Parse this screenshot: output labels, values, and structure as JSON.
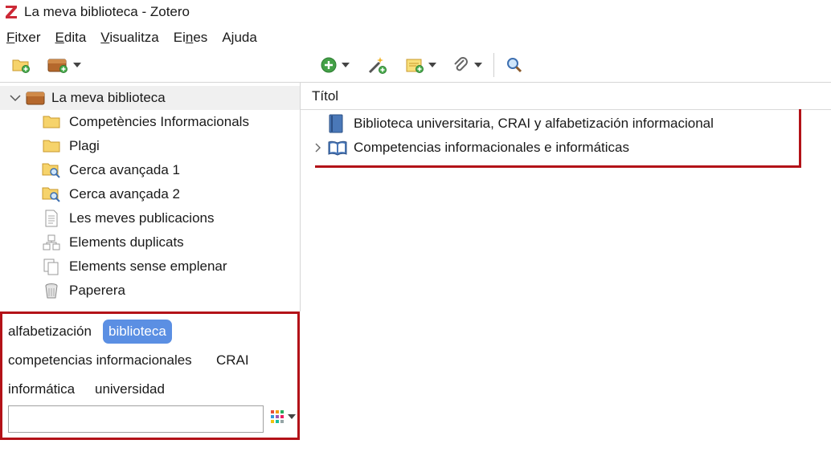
{
  "window": {
    "title": "La meva biblioteca - Zotero"
  },
  "menu": [
    {
      "label": "Fitxer",
      "mnemonic": "F",
      "rest": "itxer"
    },
    {
      "label": "Edita",
      "mnemonic": "E",
      "rest": "dita"
    },
    {
      "label": "Visualitza",
      "mnemonic": "V",
      "rest": "isualitza"
    },
    {
      "label": "Eines",
      "pre": "Ei",
      "mnemonic": "n",
      "rest": "es"
    },
    {
      "label": "Ajuda",
      "pre": "A",
      "mnemonic": "j",
      "rest": "uda"
    }
  ],
  "toolbar": {
    "icons": [
      "new-collection-icon",
      "new-library-icon",
      "new-item-icon",
      "add-by-identifier-icon",
      "new-note-icon",
      "attachment-icon",
      "search-icon"
    ]
  },
  "library": {
    "name": "La meva biblioteca",
    "collections": [
      {
        "label": "Competències Informacionals",
        "icon": "folder-icon"
      },
      {
        "label": "Plagi",
        "icon": "folder-icon"
      },
      {
        "label": "Cerca avançada 1",
        "icon": "saved-search-icon"
      },
      {
        "label": "Cerca avançada 2",
        "icon": "saved-search-icon"
      },
      {
        "label": "Les meves publicacions",
        "icon": "publications-icon"
      },
      {
        "label": "Elements duplicats",
        "icon": "duplicates-icon"
      },
      {
        "label": "Elements sense emplenar",
        "icon": "unfiled-icon"
      },
      {
        "label": "Paperera",
        "icon": "trash-icon"
      }
    ]
  },
  "items": {
    "column_title": "Títol",
    "rows": [
      {
        "title": "Biblioteca universitaria, CRAI y alfabetización informacional",
        "icon": "journal-article-icon"
      },
      {
        "title": "Competencias informacionales e informáticas",
        "icon": "book-icon"
      }
    ]
  },
  "tags": {
    "list": [
      {
        "label": "alfabetización",
        "selected": false
      },
      {
        "label": "biblioteca",
        "selected": true
      },
      {
        "label": "competencias informacionales",
        "selected": false
      },
      {
        "label": "CRAI",
        "selected": false
      },
      {
        "label": "informática",
        "selected": false
      },
      {
        "label": "universidad",
        "selected": false
      }
    ],
    "filter_value": "",
    "selected_color": "#5b8fe3"
  },
  "highlight_color": "#b31218"
}
